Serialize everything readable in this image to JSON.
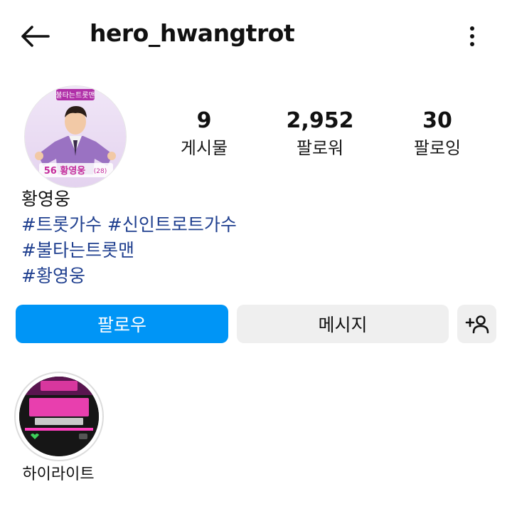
{
  "header": {
    "username": "hero_hwangtrot",
    "back_icon": "arrow-left-icon",
    "more_icon": "more-vertical-icon"
  },
  "profile": {
    "avatar_badge_text": "56 황영웅",
    "avatar_badge_age": "(28)",
    "avatar_logo_text": "불타는트롯맨"
  },
  "stats": {
    "posts": {
      "value": "9",
      "label": "게시물"
    },
    "followers": {
      "value": "2,952",
      "label": "팔로워"
    },
    "following": {
      "value": "30",
      "label": "팔로잉"
    }
  },
  "bio": {
    "name": "황영웅",
    "lines": [
      "#트롯가수 #신인트로트가수",
      "#불타는트롯맨",
      "#황영웅"
    ]
  },
  "actions": {
    "follow_label": "팔로우",
    "message_label": "메시지",
    "add_user_icon": "add-user-icon"
  },
  "highlights": [
    {
      "label": "하이라이트"
    }
  ],
  "colors": {
    "accent": "#0095f6",
    "hashtag": "#1f3f8f",
    "secondary_button": "#efefef"
  }
}
